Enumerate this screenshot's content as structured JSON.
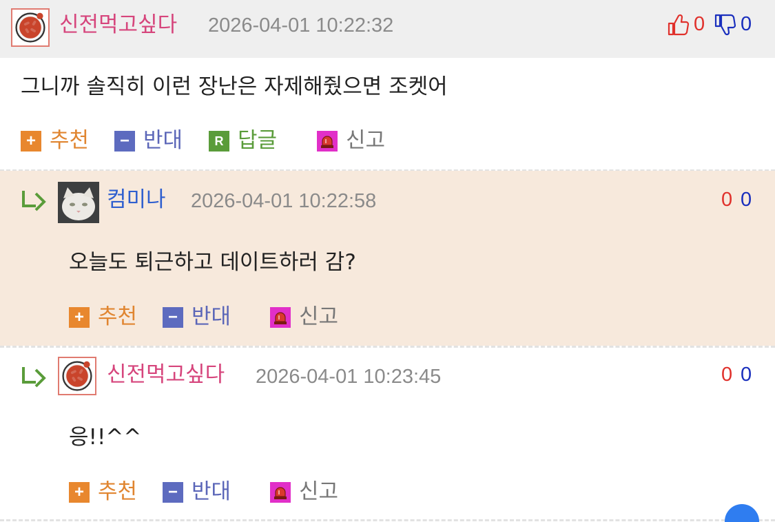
{
  "comment": {
    "nickname": "신전먹고싶다",
    "timestamp": "2026-04-01 10:22:32",
    "upvotes": "0",
    "downvotes": "0",
    "body": "그니까 솔직히 이런 장난은 자제해줬으면 조켓어",
    "actions": {
      "recommend": "추천",
      "oppose": "반대",
      "reply": "답글",
      "report": "신고"
    },
    "icons": {
      "avatar": "tteokbokki-avatar-icon",
      "up": "thumbs-up-icon",
      "down": "thumbs-down-icon"
    }
  },
  "replies": [
    {
      "nickname": "컴미나",
      "timestamp": "2026-04-01 10:22:58",
      "upvotes": "0",
      "downvotes": "0",
      "body": "오늘도 퇴근하고 데이트하러 감?",
      "actions": {
        "recommend": "추천",
        "oppose": "반대",
        "report": "신고"
      },
      "avatar": "white-cat-avatar"
    },
    {
      "nickname": "신전먹고싶다",
      "timestamp": "2026-04-01 10:23:45",
      "upvotes": "0",
      "downvotes": "0",
      "body": "응!!^^",
      "actions": {
        "recommend": "추천",
        "oppose": "반대",
        "report": "신고"
      },
      "avatar": "tteokbokki-avatar-icon"
    }
  ],
  "colors": {
    "nick_pink": "#d6457c",
    "nick_blue": "#2f5fcf",
    "up_red": "#e0312c",
    "down_blue": "#1a2fbd",
    "reply_bg": "#f7e9dc",
    "header_bg": "#efefef",
    "fab_blue": "#2f7df0"
  }
}
